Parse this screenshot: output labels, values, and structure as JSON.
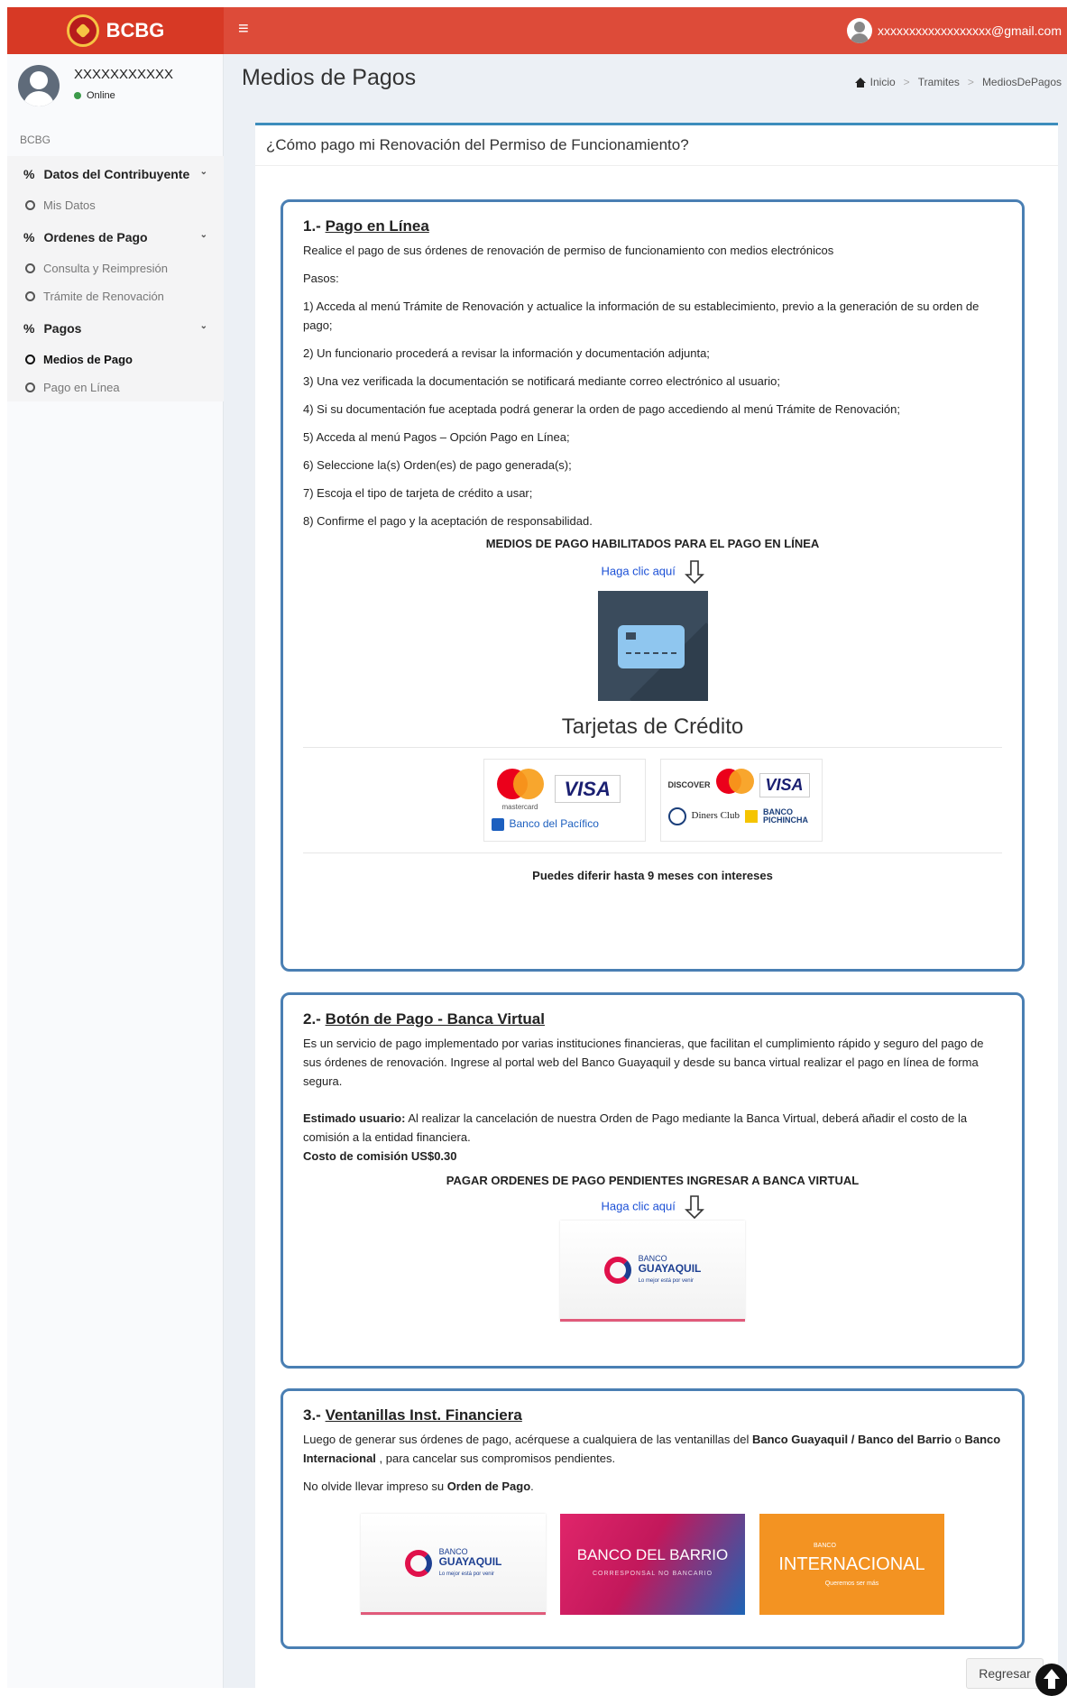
{
  "header": {
    "brand": "BCBG",
    "user_email": "xxxxxxxxxxxxxxxxxx@gmail.com"
  },
  "sidebar": {
    "user_name": "XXXXXXXXXXX",
    "user_status": "Online",
    "section": "BCBG",
    "groups": [
      {
        "label": "Datos del Contribuyente",
        "items": [
          "Mis Datos"
        ]
      },
      {
        "label": "Ordenes de Pago",
        "items": [
          "Consulta y Reimpresión",
          "Trámite de Renovación"
        ]
      },
      {
        "label": "Pagos",
        "items": [
          "Medios de Pago",
          "Pago en Línea"
        ]
      }
    ]
  },
  "page": {
    "title": "Medios de Pagos",
    "breadcrumb": [
      "Inicio",
      "Tramites",
      "MediosDePagos"
    ],
    "card_title": "¿Cómo pago mi Renovación del Permiso de Funcionamiento?"
  },
  "sec1": {
    "num": "1.-",
    "title": "Pago en Línea",
    "intro": "Realice el pago de sus órdenes de renovación de permiso de funcionamiento con medios electrónicos",
    "pasos_label": "Pasos:",
    "steps": [
      "1) Acceda al menú Trámite de Renovación y actualice la información de su establecimiento, previo a la generación de su orden de pago;",
      "2) Un funcionario procederá a revisar la información y documentación adjunta;",
      "3) Una vez verificada la documentación se notificará mediante correo electrónico al usuario;",
      "4) Si su documentación fue aceptada podrá generar la orden de pago accediendo al menú Trámite de Renovación;",
      "5) Acceda al menú Pagos – Opción Pago en Línea;",
      "6) Seleccione la(s) Orden(es) de pago generada(s);",
      "7) Escoja el tipo de tarjeta de crédito a usar;",
      "8) Confirme el pago y la aceptación de responsabilidad."
    ],
    "medios_heading": "MEDIOS DE PAGO HABILITADOS PARA EL PAGO EN LÍNEA",
    "link": "Haga clic aquí",
    "cc_title": "Tarjetas de Crédito",
    "logo1": {
      "mc_text": "mastercard",
      "visa": "VISA",
      "bank": "Banco del Pacífico"
    },
    "logo2": {
      "discover": "DISCOVER",
      "visa": "VISA",
      "diners": "Diners Club",
      "pichincha_1": "BANCO",
      "pichincha_2": "PICHINCHA"
    },
    "diferir": "Puedes diferir hasta 9 meses con intereses"
  },
  "sec2": {
    "num": "2.-",
    "title": "Botón de Pago - Banca Virtual",
    "p1": "Es un servicio de pago implementado por varias instituciones financieras, que facilitan el cumplimiento rápido y seguro del pago de sus órdenes de renovación. Ingrese al portal web del Banco Guayaquil y desde su banca virtual realizar el pago en línea de forma segura.",
    "estimado_label": "Estimado usuario:",
    "estimado_text": " Al realizar la cancelación de nuestra Orden de Pago mediante la Banca Virtual, deberá añadir el costo de la comisión a la entidad financiera.",
    "costo": "Costo de comisión US$0.30",
    "heading": "PAGAR ORDENES DE PAGO PENDIENTES INGRESAR A BANCA VIRTUAL",
    "link": "Haga clic aquí"
  },
  "sec3": {
    "num": "3.-",
    "title": "Ventanillas Inst. Financiera",
    "p1_a": "Luego de generar sus órdenes de pago, acérquese a cualquiera de las ventanillas del ",
    "p1_b": "Banco Guayaquil / Banco del Barrio",
    "p1_c": " o ",
    "p1_d": "Banco Internacional",
    "p1_e": " , para cancelar sus compromisos pendientes.",
    "p2_a": "No olvide llevar impreso su ",
    "p2_b": "Orden de Pago",
    "p2_c": "."
  },
  "banks": {
    "guayaquil_1": "BANCO",
    "guayaquil_2": "GUAYAQUIL",
    "guayaquil_tag": "Lo mejor está por venir",
    "barrio": "BANCO DEL BARRIO",
    "barrio_sub": "CORRESPONSAL NO BANCARIO",
    "internacional_small": "BANCO",
    "internacional": "INTERNACIONAL",
    "internacional_tag": "Queremos ser más"
  },
  "footer": {
    "back": "Regresar"
  }
}
